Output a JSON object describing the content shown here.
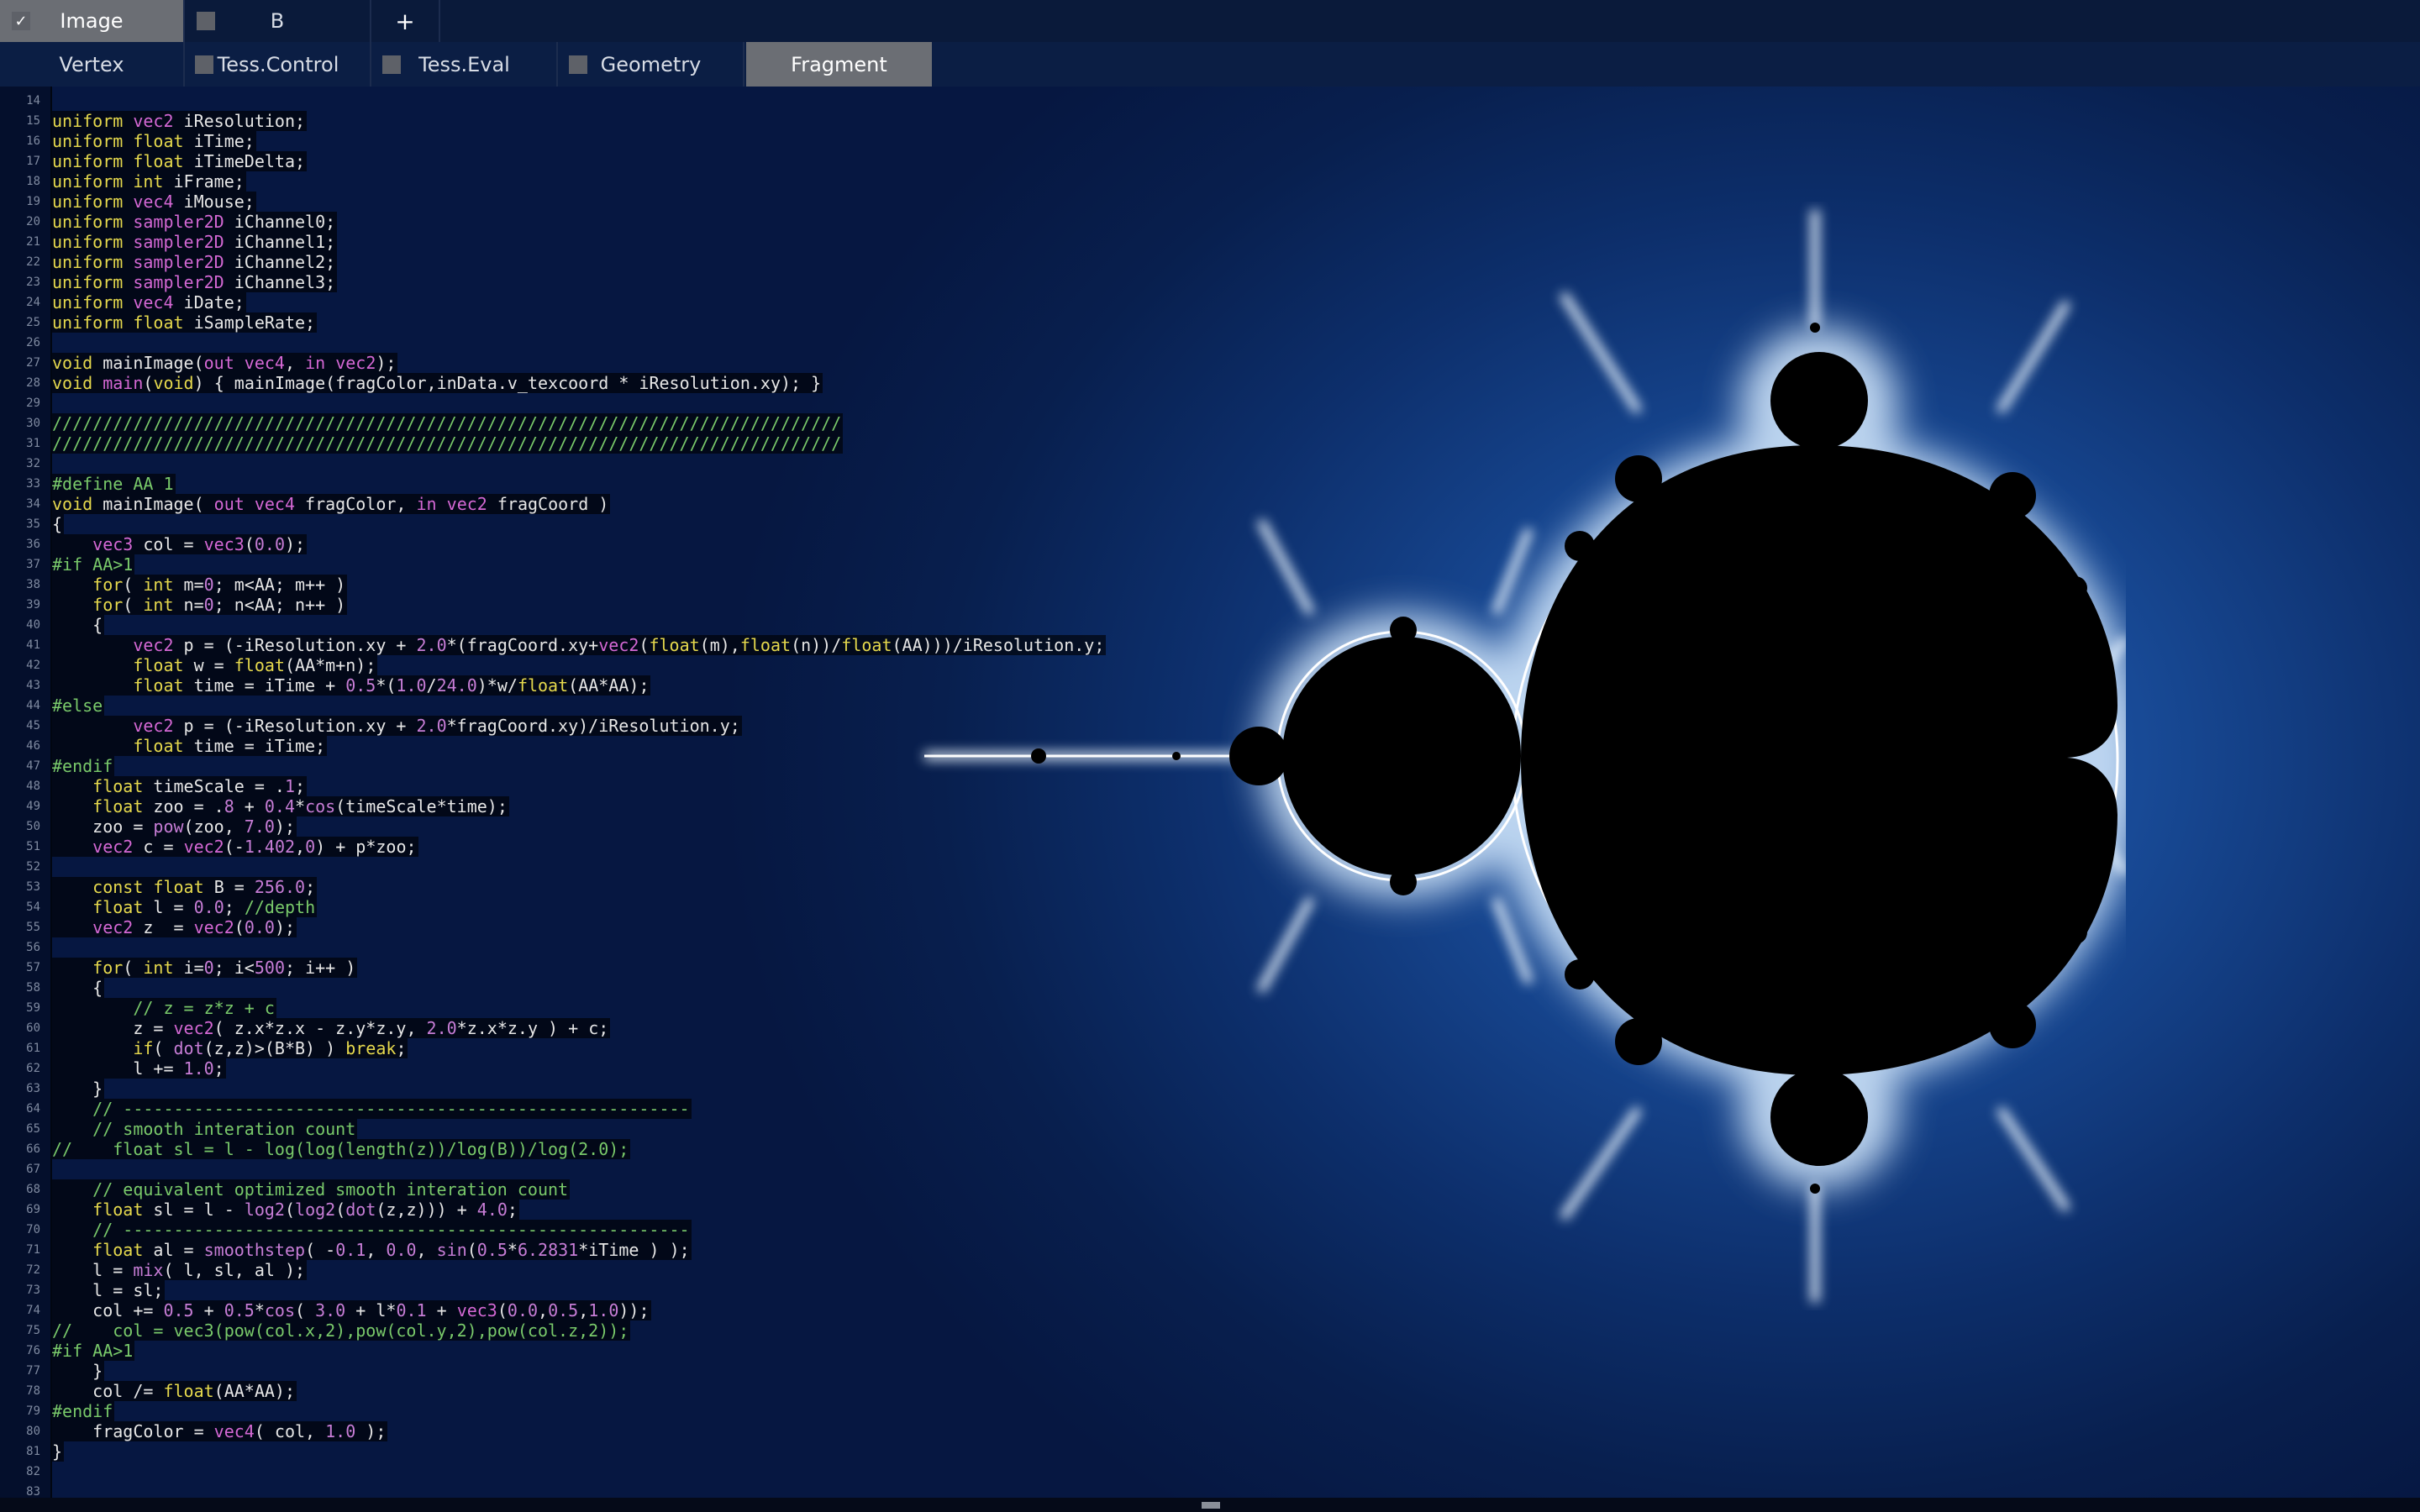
{
  "buffer_tabs": [
    {
      "label": "Image",
      "checked": true,
      "active": true
    },
    {
      "label": "B",
      "checked": false,
      "active": false
    },
    {
      "label": "+"
    }
  ],
  "shader_tabs": [
    {
      "label": "Vertex",
      "checkbox": false,
      "active": false
    },
    {
      "label": "Tess.Control",
      "checkbox": true,
      "active": false
    },
    {
      "label": "Tess.Eval",
      "checkbox": true,
      "active": false
    },
    {
      "label": "Geometry",
      "checkbox": true,
      "active": false
    },
    {
      "label": "Fragment",
      "checkbox": false,
      "active": true
    }
  ],
  "code": {
    "line_numbers": [
      "14",
      "15",
      "16",
      "17",
      "18",
      "19",
      "20",
      "21",
      "22",
      "23",
      "24",
      "25",
      "26",
      "27",
      "28",
      "29",
      "30",
      "31",
      "32",
      "33",
      "34",
      "35",
      "36",
      "37",
      "38",
      "39",
      "40",
      "41",
      "42",
      "43",
      "44",
      "45",
      "46",
      "47",
      "48",
      "49",
      "50",
      "51",
      "52",
      "53",
      "54",
      "55",
      "56",
      "57",
      "58",
      "59",
      "60",
      "61",
      "62",
      "63",
      "64",
      "65",
      "66",
      "67",
      "68",
      "69",
      "70",
      "71",
      "72",
      "73",
      "74",
      "75",
      "76",
      "77",
      "78",
      "79",
      "80",
      "81",
      "82",
      "83"
    ],
    "lines": [
      "",
      "uniform vec2 iResolution;",
      "uniform float iTime;",
      "uniform float iTimeDelta;",
      "uniform int iFrame;",
      "uniform vec4 iMouse;",
      "uniform sampler2D iChannel0;",
      "uniform sampler2D iChannel1;",
      "uniform sampler2D iChannel2;",
      "uniform sampler2D iChannel3;",
      "uniform vec4 iDate;",
      "uniform float iSampleRate;",
      "",
      "void mainImage(out vec4, in vec2);",
      "void main(void) { mainImage(fragColor,inData.v_texcoord * iResolution.xy); }",
      "",
      "//////////////////////////////////////////////////////////////////////////////",
      "//////////////////////////////////////////////////////////////////////////////",
      "",
      "#define AA 1",
      "void mainImage( out vec4 fragColor, in vec2 fragCoord )",
      "{",
      "    vec3 col = vec3(0.0);",
      "#if AA>1",
      "    for( int m=0; m<AA; m++ )",
      "    for( int n=0; n<AA; n++ )",
      "    {",
      "        vec2 p = (-iResolution.xy + 2.0*(fragCoord.xy+vec2(float(m),float(n))/float(AA)))/iResolution.y;",
      "        float w = float(AA*m+n);",
      "        float time = iTime + 0.5*(1.0/24.0)*w/float(AA*AA);",
      "#else",
      "        vec2 p = (-iResolution.xy + 2.0*fragCoord.xy)/iResolution.y;",
      "        float time = iTime;",
      "#endif",
      "    float timeScale = .1;",
      "    float zoo = .8 + 0.4*cos(timeScale*time);",
      "    zoo = pow(zoo, 7.0);",
      "    vec2 c = vec2(-1.402,0) + p*zoo;",
      "",
      "    const float B = 256.0;",
      "    float l = 0.0; //depth",
      "    vec2 z  = vec2(0.0);",
      "",
      "    for( int i=0; i<500; i++ )",
      "    {",
      "        // z = z*z + c",
      "        z = vec2( z.x*z.x - z.y*z.y, 2.0*z.x*z.y ) + c;",
      "        if( dot(z,z)>(B*B) ) break;",
      "        l += 1.0;",
      "    }",
      "    // --------------------------------------------------------",
      "    // smooth interation count",
      "//    float sl = l - log(log(length(z))/log(B))/log(2.0);",
      "",
      "    // equivalent optimized smooth interation count",
      "    float sl = l - log2(log2(dot(z,z))) + 4.0;",
      "    // --------------------------------------------------------",
      "    float al = smoothstep( -0.1, 0.0, sin(0.5*6.2831*iTime ) );",
      "    l = mix( l, sl, al );",
      "    l = sl;",
      "    col += 0.5 + 0.5*cos( 3.0 + l*0.1 + vec3(0.0,0.5,1.0));",
      "//    col = vec3(pow(col.x,2),pow(col.y,2),pow(col.z,2));",
      "#if AA>1",
      "    }",
      "    col /= float(AA*AA);",
      "#endif",
      "    fragColor = vec4( col, 1.0 );",
      "}",
      "",
      ""
    ]
  },
  "colors": {
    "keyword": "#e6d94d",
    "type": "#d468d4",
    "number": "#c77dd6",
    "comment": "#79c96a",
    "text": "#e6e6e6",
    "active_tab": "#6b6e74"
  }
}
